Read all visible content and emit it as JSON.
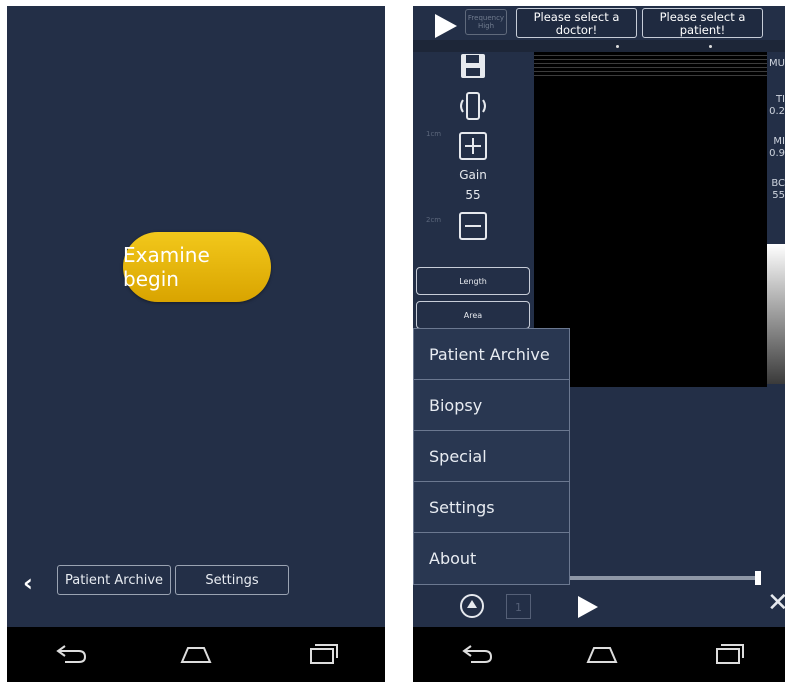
{
  "left_screen": {
    "examine_button": "Examine begin",
    "bottom_bar": {
      "back_icon": "chevron-left-icon",
      "patient_archive": "Patient Archive",
      "settings": "Settings"
    }
  },
  "right_screen": {
    "header": {
      "select_doctor": "Please select a doctor!",
      "select_patient": "Please select a patient!",
      "frequency_label": "Frequency High"
    },
    "toolbar": {
      "gain_label": "Gain",
      "gain_value": "55",
      "length_button": "Length",
      "area_button": "Area"
    },
    "ruler_labels": [
      "1cm",
      "2cm"
    ],
    "right_edge_labels": [
      "MU",
      "TI",
      "0.2",
      "MI",
      "0.9",
      "BC",
      "55"
    ],
    "menu": [
      "Patient Archive",
      "Biopsy",
      "Special",
      "Settings",
      "About"
    ],
    "bottom_controls": {
      "page_number": "1",
      "close_icon": "close-icon"
    }
  },
  "system_nav": {
    "icons": [
      "back-icon",
      "home-icon",
      "recent-apps-icon"
    ]
  },
  "colors": {
    "background": "#232f47",
    "accent_button": "#e8b60c",
    "nav_bar": "#000000"
  }
}
